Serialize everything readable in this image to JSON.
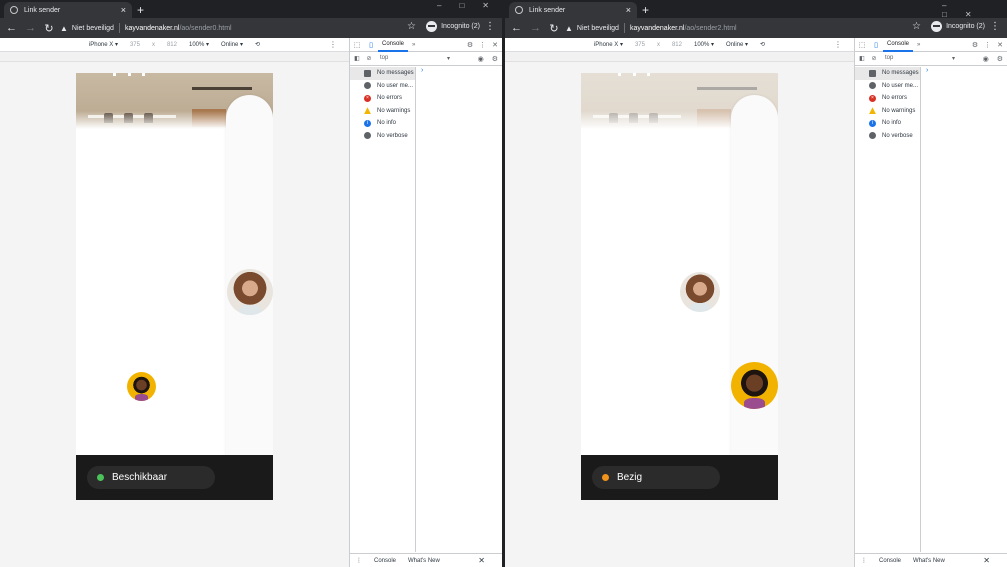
{
  "windows": [
    {
      "tab_title": "Link sender",
      "security": "Niet beveiligd",
      "url_host": "kayvandenaker.nl",
      "url_path": "/ao/sender0.html",
      "incognito": "Incognito (2)",
      "device": "iPhone X ▾",
      "width": "375",
      "times": "x",
      "height": "812",
      "zoom": "100% ▾",
      "throttle": "Online ▾",
      "status_label": "Beschikbaar",
      "status_color": "#4cc25a"
    },
    {
      "tab_title": "Link sender",
      "security": "Niet beveiligd",
      "url_host": "kayvandenaker.nl",
      "url_path": "/ao/sender2.html",
      "incognito": "Incognito (2)",
      "device": "iPhone X ▾",
      "width": "375",
      "times": "x",
      "height": "812",
      "zoom": "100% ▾",
      "throttle": "Online ▾",
      "status_label": "Bezig",
      "status_color": "#f0931c"
    }
  ],
  "devtools": {
    "console_tab": "Console",
    "more_tabs": "»",
    "context": "top",
    "context_arrow": "▾",
    "prompt": "›",
    "filters": [
      {
        "label": "No messages",
        "icon": "list-icon",
        "color": "#5f6368"
      },
      {
        "label": "No user me...",
        "icon": "user-icon",
        "color": "#5f6368"
      },
      {
        "label": "No errors",
        "icon": "error-icon",
        "color": "#d93025"
      },
      {
        "label": "No warnings",
        "icon": "warning-icon",
        "color": "#f2b600"
      },
      {
        "label": "No info",
        "icon": "info-icon",
        "color": "#1a73e8"
      },
      {
        "label": "No verbose",
        "icon": "verbose-icon",
        "color": "#5f6368"
      }
    ],
    "drawer_console": "Console",
    "drawer_whatsnew": "What's New"
  }
}
